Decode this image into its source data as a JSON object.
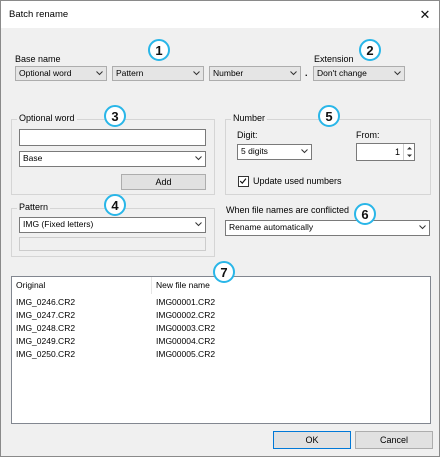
{
  "window": {
    "title": "Batch rename"
  },
  "base_name": {
    "label": "Base name",
    "field1": "Optional word",
    "field2": "Pattern",
    "field3": "Number",
    "dot": "."
  },
  "extension": {
    "label": "Extension",
    "value": "Don't change"
  },
  "optional_word": {
    "legend": "Optional word",
    "input_value": "",
    "dropdown": "Base",
    "add_label": "Add"
  },
  "number": {
    "legend": "Number",
    "digit_label": "Digit:",
    "digit_value": "5 digits",
    "from_label": "From:",
    "from_value": "1",
    "update_label": "Update used numbers",
    "update_checked": true
  },
  "pattern": {
    "legend": "Pattern",
    "value": "IMG (Fixed letters)"
  },
  "conflict": {
    "label": "When file names are conflicted",
    "value": "Rename automatically"
  },
  "list": {
    "columns": [
      "Original",
      "New file name"
    ],
    "rows": [
      {
        "original": "IMG_0246.CR2",
        "new": "IMG00001.CR2"
      },
      {
        "original": "IMG_0247.CR2",
        "new": "IMG00002.CR2"
      },
      {
        "original": "IMG_0248.CR2",
        "new": "IMG00003.CR2"
      },
      {
        "original": "IMG_0249.CR2",
        "new": "IMG00004.CR2"
      },
      {
        "original": "IMG_0250.CR2",
        "new": "IMG00005.CR2"
      }
    ]
  },
  "buttons": {
    "ok": "OK",
    "cancel": "Cancel"
  },
  "callouts": [
    "1",
    "2",
    "3",
    "4",
    "5",
    "6",
    "7"
  ],
  "colors": {
    "callout_border": "#29b6e8",
    "focus_border": "#0078d7"
  }
}
